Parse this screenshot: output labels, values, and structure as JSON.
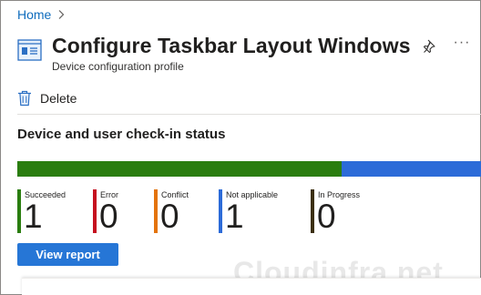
{
  "breadcrumb": {
    "home_label": "Home",
    "separator": ">"
  },
  "header": {
    "title": "Configure Taskbar Layout Windows",
    "subtitle": "Device configuration profile",
    "page_icon": "device-configuration-icon",
    "pin_icon": "pin-icon",
    "more_label": "···"
  },
  "toolbar": {
    "delete_label": "Delete",
    "delete_icon": "trash-icon"
  },
  "section": {
    "title": "Device and user check-in status"
  },
  "status": {
    "segments": [
      {
        "name": "Succeeded",
        "count": 1,
        "color": "#2a7d0f"
      },
      {
        "name": "Not applicable",
        "count": 1,
        "color": "#2c6bd8"
      }
    ],
    "items": [
      {
        "label": "Succeeded",
        "value": "1",
        "color": "#2a7d0f"
      },
      {
        "label": "Error",
        "value": "0",
        "color": "#c50f1f"
      },
      {
        "label": "Conflict",
        "value": "0",
        "color": "#e3730b"
      },
      {
        "label": "Not applicable",
        "value": "1",
        "color": "#2c6bd8"
      },
      {
        "label": "In Progress",
        "value": "0",
        "color": "#3b2f0e"
      }
    ]
  },
  "actions": {
    "view_report_label": "View report"
  },
  "watermark": {
    "text": "Cloudinfra.net"
  }
}
